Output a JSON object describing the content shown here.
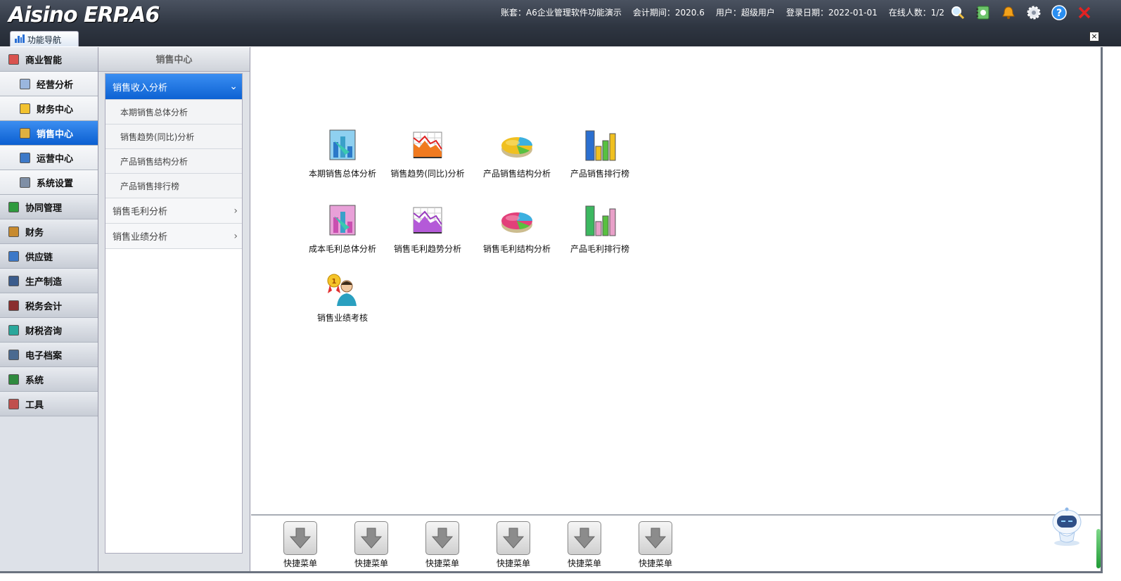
{
  "header": {
    "logo": "Aisino ERP.A6",
    "account": "账套：A6企业管理软件功能演示",
    "period": "会计期间：2020.6",
    "user": "用户：超级用户",
    "login_date": "登录日期：2022-01-01",
    "online": "在线人数：1/2",
    "icons": [
      "search-icon",
      "notebook-icon",
      "bell-icon",
      "gear-icon",
      "help-icon",
      "close-icon"
    ]
  },
  "tabs": {
    "nav_tab": "功能导航"
  },
  "leftnav": {
    "items": [
      {
        "label": "商业智能",
        "level": "top",
        "icon": "bi-icon"
      },
      {
        "label": "经营分析",
        "level": "sub",
        "icon": "chart-icon"
      },
      {
        "label": "财务中心",
        "level": "sub",
        "icon": "finance-icon"
      },
      {
        "label": "销售中心",
        "level": "sub",
        "icon": "sales-icon",
        "active": true
      },
      {
        "label": "运营中心",
        "level": "sub",
        "icon": "ops-icon"
      },
      {
        "label": "系统设置",
        "level": "sub",
        "icon": "settings-icon"
      },
      {
        "label": "协同管理",
        "level": "top",
        "icon": "collab-icon"
      },
      {
        "label": "财务",
        "level": "top",
        "icon": "money-icon"
      },
      {
        "label": "供应链",
        "level": "top",
        "icon": "link-icon"
      },
      {
        "label": "生产制造",
        "level": "top",
        "icon": "factory-icon"
      },
      {
        "label": "税务会计",
        "level": "top",
        "icon": "tax-icon"
      },
      {
        "label": "财税咨询",
        "level": "top",
        "icon": "consult-icon"
      },
      {
        "label": "电子档案",
        "level": "top",
        "icon": "archive-icon"
      },
      {
        "label": "系统",
        "level": "top",
        "icon": "system-icon"
      },
      {
        "label": "工具",
        "level": "top",
        "icon": "tools-icon"
      }
    ]
  },
  "subpanel": {
    "title": "销售中心",
    "groups": [
      {
        "label": "销售收入分析",
        "open": true,
        "children": [
          "本期销售总体分析",
          "销售趋势(同比)分析",
          "产品销售结构分析",
          "产品销售排行榜"
        ]
      },
      {
        "label": "销售毛利分析",
        "open": false,
        "children": []
      },
      {
        "label": "销售业绩分析",
        "open": false,
        "children": []
      }
    ]
  },
  "main": {
    "tiles": [
      {
        "label": "本期销售总体分析",
        "icon": "bar-chart-blue-icon"
      },
      {
        "label": "销售趋势(同比)分析",
        "icon": "trend-chart-orange-icon"
      },
      {
        "label": "产品销售结构分析",
        "icon": "pie-chart-yellow-icon"
      },
      {
        "label": "产品销售排行榜",
        "icon": "ranking-bars-blue-icon"
      },
      {
        "label": "成本毛利总体分析",
        "icon": "bar-chart-pink-icon"
      },
      {
        "label": "销售毛利趋势分析",
        "icon": "trend-chart-purple-icon"
      },
      {
        "label": "销售毛利结构分析",
        "icon": "pie-chart-pink-icon"
      },
      {
        "label": "产品毛利排行榜",
        "icon": "ranking-bars-green-icon"
      },
      {
        "label": "销售业绩考核",
        "icon": "award-person-icon"
      }
    ]
  },
  "quickbar": {
    "buttons": [
      "快捷菜单",
      "快捷菜单",
      "快捷菜单",
      "快捷菜单",
      "快捷菜单",
      "快捷菜单"
    ]
  },
  "colors": {
    "active_blue": "#0b5fd1",
    "header_dark": "#2f3642"
  }
}
